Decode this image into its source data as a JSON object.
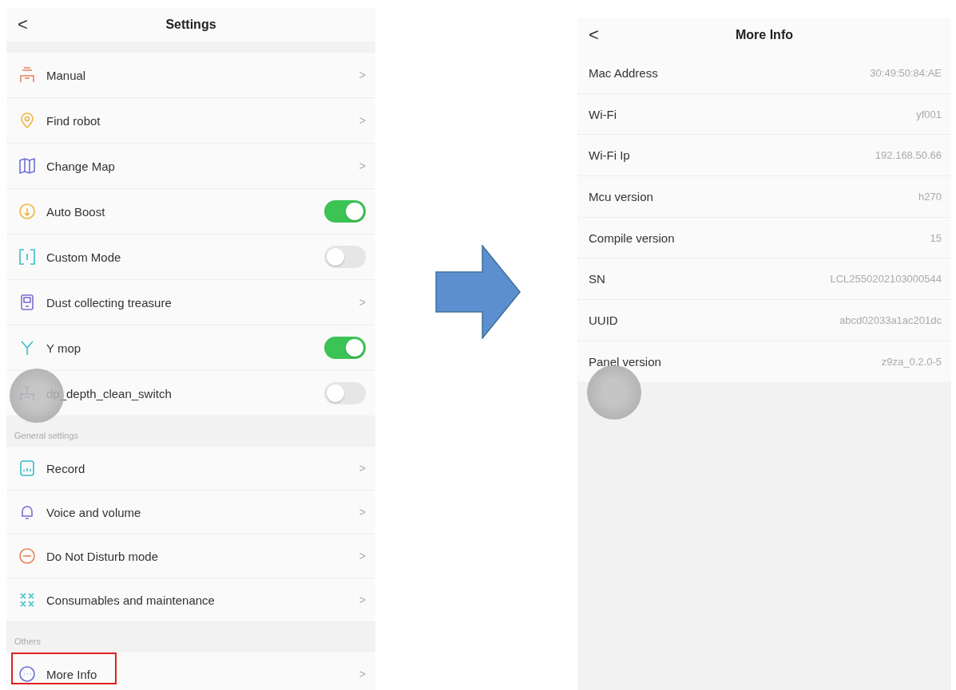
{
  "settings_screen": {
    "title": "Settings",
    "back": "<",
    "groups": [
      {
        "items": [
          {
            "label": "Manual",
            "kind": "link",
            "chevron": ">"
          },
          {
            "label": "Find robot",
            "kind": "link",
            "chevron": ">"
          },
          {
            "label": "Change Map",
            "kind": "link",
            "chevron": ">"
          },
          {
            "label": "Auto Boost",
            "kind": "toggle",
            "on": true
          },
          {
            "label": "Custom Mode",
            "kind": "toggle",
            "on": false
          },
          {
            "label": "Dust collecting treasure",
            "kind": "link",
            "chevron": ">"
          },
          {
            "label": "Y mop",
            "kind": "toggle",
            "on": true
          },
          {
            "label": "dp_depth_clean_switch",
            "kind": "toggle",
            "on": false
          }
        ]
      },
      {
        "heading": "General settings",
        "items": [
          {
            "label": "Record",
            "kind": "link",
            "chevron": ">"
          },
          {
            "label": "Voice and volume",
            "kind": "link",
            "chevron": ">"
          },
          {
            "label": "Do Not Disturb mode",
            "kind": "link",
            "chevron": ">"
          },
          {
            "label": "Consumables and maintenance",
            "kind": "link",
            "chevron": ">"
          }
        ]
      },
      {
        "heading": "Others",
        "items": [
          {
            "label": "More Info",
            "kind": "link",
            "chevron": ">",
            "highlighted": true
          }
        ]
      }
    ]
  },
  "more_info_screen": {
    "title": "More Info",
    "back": "<",
    "rows": [
      {
        "label": "Mac Address",
        "value": "30:49:50:84:AE"
      },
      {
        "label": "Wi-Fi",
        "value": "yf001"
      },
      {
        "label": "Wi-Fi Ip",
        "value": "192.168.50.66"
      },
      {
        "label": "Mcu version",
        "value": "h270"
      },
      {
        "label": "Compile version",
        "value": "15"
      },
      {
        "label": "SN",
        "value": "LCL2550202103000544"
      },
      {
        "label": "UUID",
        "value": "abcd02033a1ac201dc"
      },
      {
        "label": "Panel version",
        "value": "z9za_0.2.0-5"
      }
    ]
  }
}
